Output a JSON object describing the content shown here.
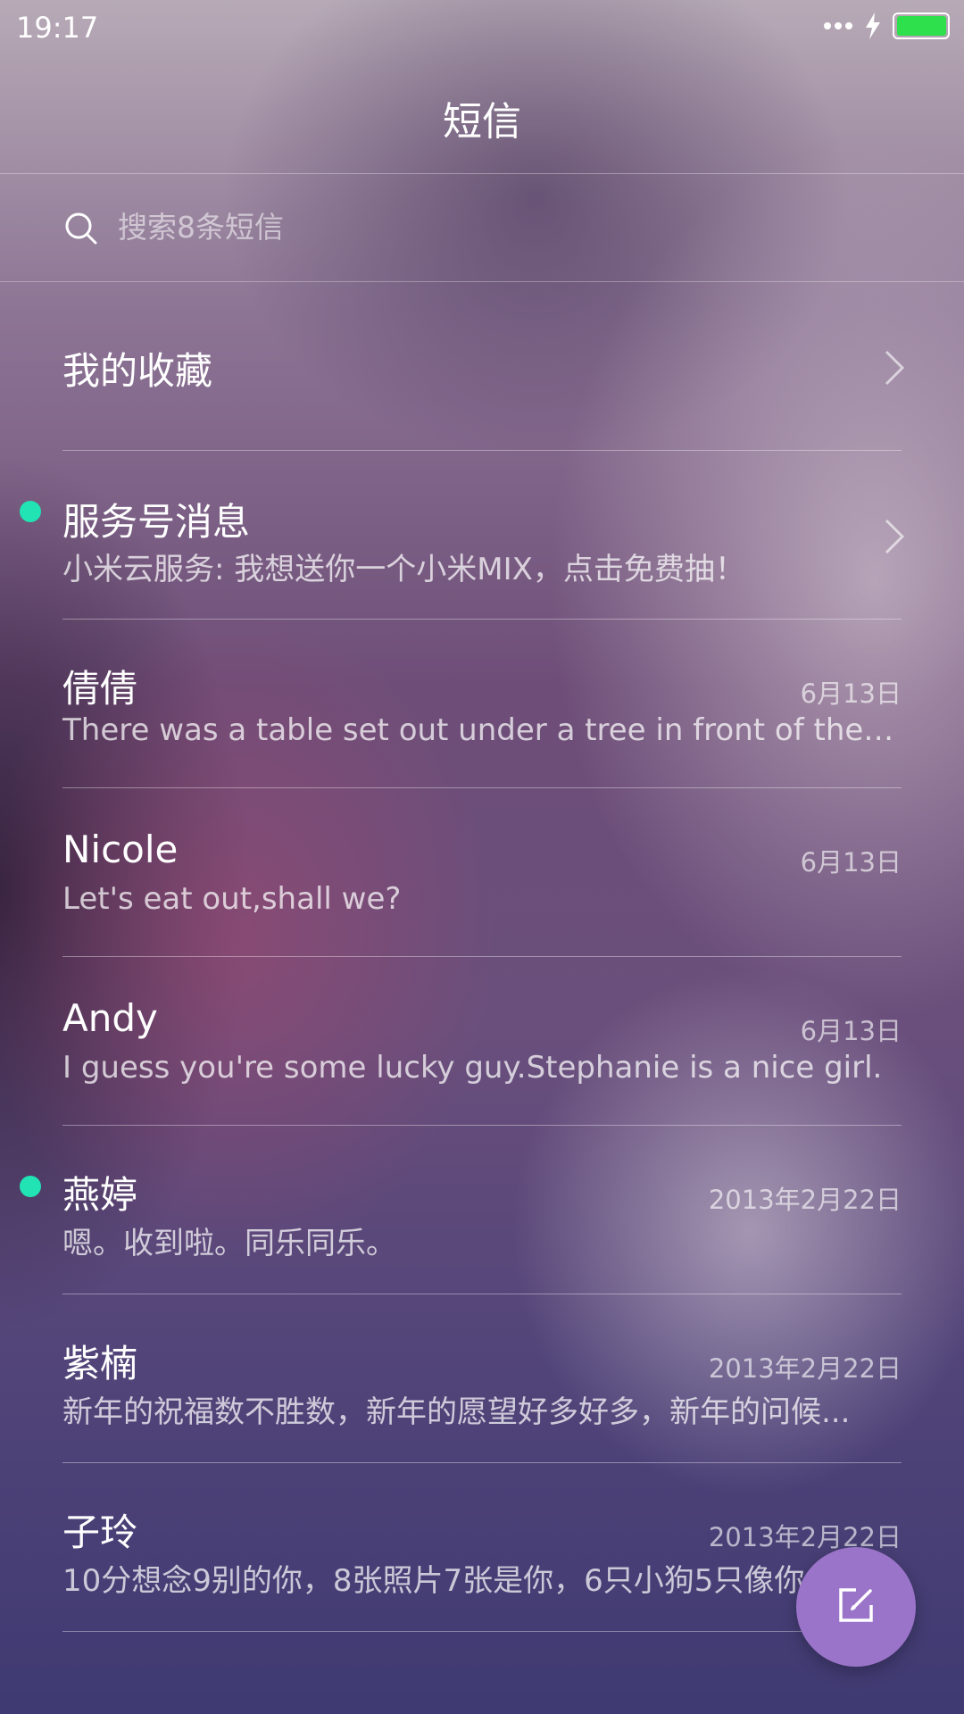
{
  "status_bar": {
    "time": "19:17",
    "battery_color": "#2ee04c"
  },
  "header": {
    "title": "短信"
  },
  "search": {
    "placeholder": "搜索8条短信"
  },
  "favorites": {
    "label": "我的收藏"
  },
  "service": {
    "title": "服务号消息",
    "preview": "小米云服务: 我想送你一个小米MIX，点击免费抽！",
    "unread": true
  },
  "conversations": [
    {
      "name": "倩倩",
      "date": "6月13日",
      "preview": "There was a table set out under a tree in front of the ho...",
      "unread": false
    },
    {
      "name": "Nicole",
      "date": "6月13日",
      "preview": "Let's eat out,shall we?",
      "unread": false
    },
    {
      "name": "Andy",
      "date": "6月13日",
      "preview": "I guess you're some lucky guy.Stephanie is a nice girl.",
      "unread": false
    },
    {
      "name": "燕婷",
      "date": "2013年2月22日",
      "preview": "嗯。收到啦。同乐同乐。",
      "unread": true
    },
    {
      "name": "紫楠",
      "date": "2013年2月22日",
      "preview": "新年的祝福数不胜数，新年的愿望好多好多，新年的问候...",
      "unread": false
    },
    {
      "name": "子玲",
      "date": "2013年2月22日",
      "preview": "10分想念9别的你，8张照片7张是你，6只小狗5只像你",
      "unread": false
    }
  ],
  "icons": {
    "search": "search-icon",
    "chevron": "chevron-right-icon",
    "compose": "compose-icon"
  },
  "colors": {
    "unread_dot": "#21e3b3",
    "fab": "#9a74c8"
  }
}
